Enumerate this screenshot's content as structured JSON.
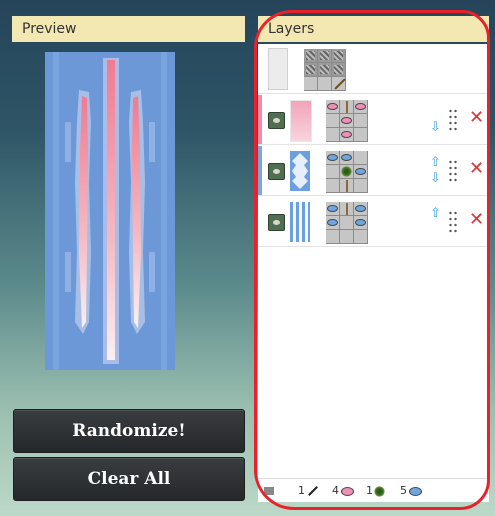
{
  "preview": {
    "title": "Preview"
  },
  "layers": {
    "title": "Layers",
    "rows": [
      {
        "kind": "base",
        "grid": [
          "wool",
          "wool",
          "wool",
          "wool",
          "wool",
          "wool",
          "",
          "",
          "stick"
        ]
      },
      {
        "kind": "layer",
        "color": "#f0a0b4",
        "stripe": "#ec8cab",
        "pattern": "pale",
        "arrows": [
          "down"
        ],
        "grid": [
          "pink",
          "stick",
          "pink",
          "",
          "pink",
          "",
          "",
          "pink",
          ""
        ]
      },
      {
        "kind": "layer",
        "color": "#6aa0dc",
        "stripe": "#7aa6e0",
        "pattern": "flower",
        "arrows": [
          "up",
          "down"
        ],
        "grid": [
          "blue",
          "blue",
          "",
          "",
          "vine",
          "blue",
          "",
          "stick",
          ""
        ]
      },
      {
        "kind": "layer",
        "color": "#6aa0dc",
        "stripe": "",
        "pattern": "stripes",
        "arrows": [
          "up"
        ],
        "grid": [
          "blue",
          "stick",
          "blue",
          "blue",
          "",
          "blue",
          "",
          "",
          ""
        ]
      }
    ]
  },
  "footer": {
    "items": [
      {
        "count": "",
        "icon": "wool-icon"
      },
      {
        "count": "1",
        "icon": "stick-icon"
      },
      {
        "count": "4",
        "icon": "pink-dye-icon"
      },
      {
        "count": "1",
        "icon": "vine-icon"
      },
      {
        "count": "5",
        "icon": "blue-dye-icon"
      }
    ]
  },
  "buttons": {
    "randomize": "Randomize!",
    "clear_all": "Clear All"
  },
  "colors": {
    "pink": "#f08fb5",
    "blue": "#6fa6e2",
    "banner_base": "#6c98d8"
  }
}
